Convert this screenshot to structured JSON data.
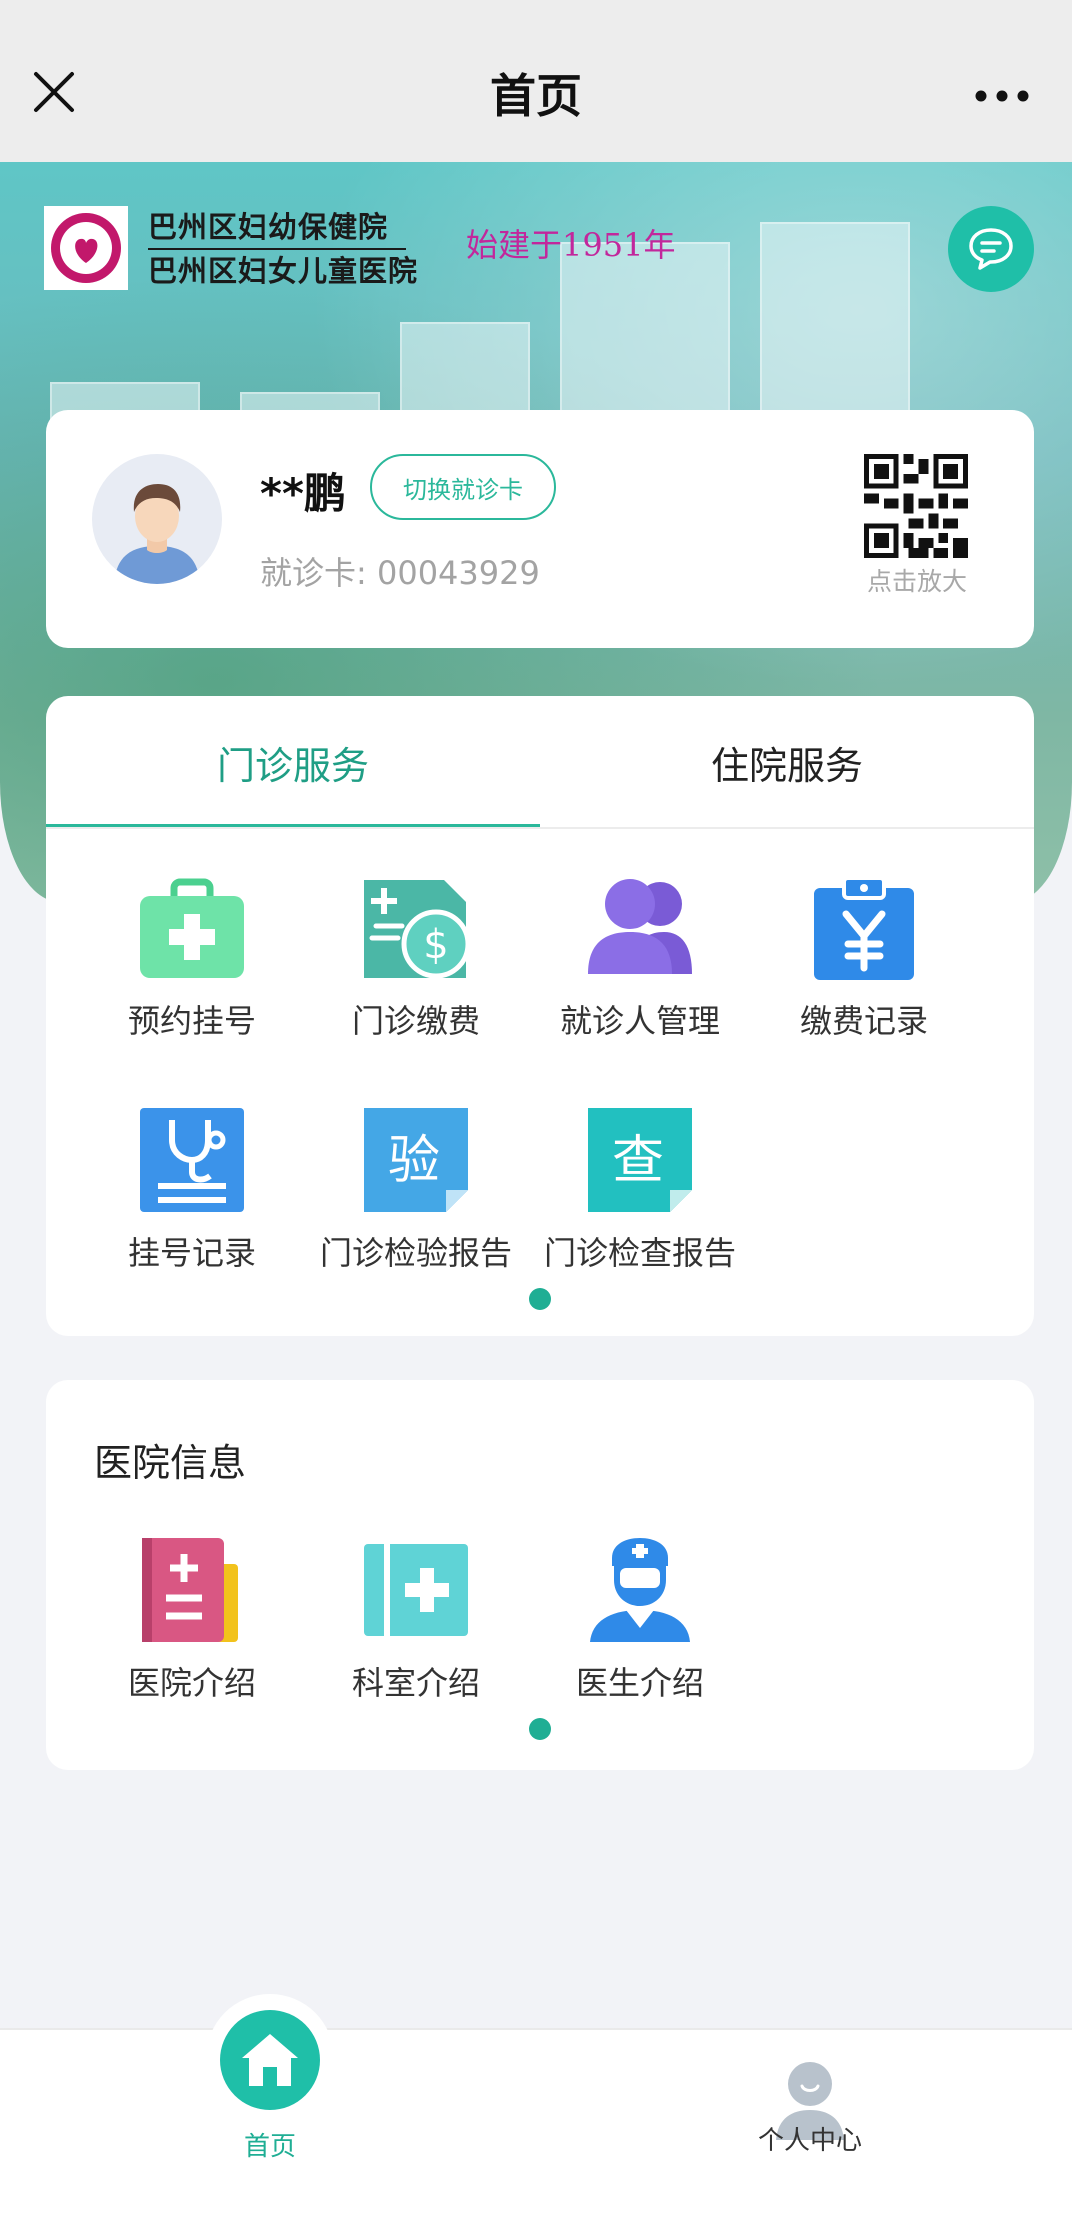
{
  "header": {
    "title": "首页",
    "close_icon": "close-icon",
    "more_icon": "more-icon"
  },
  "hero": {
    "hospital_name_1": "巴州区妇幼保健院",
    "hospital_name_2": "巴州区妇女儿童医院",
    "founded": "始建于1951年",
    "chat_icon": "chat-bubble-icon"
  },
  "patient": {
    "name": "**鹏",
    "switch_label": "切换就诊卡",
    "card_label": "就诊卡:",
    "card_number": "00043929",
    "qr_caption": "点击放大"
  },
  "services": {
    "tabs": [
      {
        "label": "门诊服务",
        "active": true
      },
      {
        "label": "住院服务",
        "active": false
      }
    ],
    "items": [
      {
        "label": "预约挂号",
        "icon": "medical-kit-icon"
      },
      {
        "label": "门诊缴费",
        "icon": "payment-icon"
      },
      {
        "label": "就诊人管理",
        "icon": "patients-icon"
      },
      {
        "label": "缴费记录",
        "icon": "yen-clipboard-icon"
      },
      {
        "label": "挂号记录",
        "icon": "stethoscope-icon"
      },
      {
        "label": "门诊检验报告",
        "icon": "lab-report-icon",
        "glyph": "验"
      },
      {
        "label": "门诊检查报告",
        "icon": "exam-report-icon",
        "glyph": "查"
      }
    ]
  },
  "hospital_info": {
    "title": "医院信息",
    "items": [
      {
        "label": "医院介绍",
        "icon": "hospital-book-icon"
      },
      {
        "label": "科室介绍",
        "icon": "department-icon"
      },
      {
        "label": "医生介绍",
        "icon": "doctor-icon"
      }
    ]
  },
  "bottom_nav": {
    "home_label": "首页",
    "me_label": "个人中心"
  },
  "colors": {
    "accent": "#1fbfa8",
    "accent_text": "#1f9e85",
    "founded_text": "#c2279c"
  }
}
